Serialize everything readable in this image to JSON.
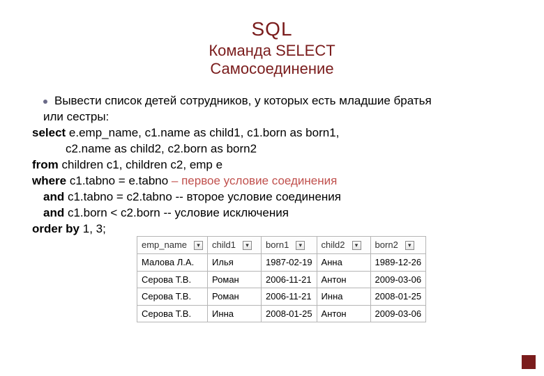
{
  "title": "SQL",
  "subtitle": "Команда SELECT",
  "subtitle2": "Самосоединение",
  "bullet_lead": "Вывести список детей сотрудников, у которых есть младшие братья",
  "bullet_tail": "или сестры:",
  "sql": {
    "select_kw": "select",
    "select_line": " e.emp_name, c1.name as child1, c1.born as born1,",
    "select_line2": "c2.name as  child2, c2.born as born2",
    "from_kw": "from",
    "from_line": " children c1, children c2, emp e",
    "where_kw": "where",
    "where_line": " c1.tabno = e.tabno ",
    "where_comment": "– первое условие соединения",
    "and1_kw": "and",
    "and1_line": " c1.tabno = c2.tabno -- второе условие соединения",
    "and2_kw": "and",
    "and2_line": " c1.born < c2.born   -- условие исключения",
    "orderby_kw": "order by",
    "orderby_line": " 1, 3;"
  },
  "table": {
    "headers": [
      "emp_name",
      "child1",
      "born1",
      "child2",
      "born2"
    ],
    "rows": [
      [
        "Малова Л.А.",
        "Илья",
        "1987-02-19",
        "Анна",
        "1989-12-26"
      ],
      [
        "Серова Т.В.",
        "Роман",
        "2006-11-21",
        "Антон",
        "2009-03-06"
      ],
      [
        "Серова Т.В.",
        "Роман",
        "2006-11-21",
        "Инна",
        "2008-01-25"
      ],
      [
        "Серова Т.В.",
        "Инна",
        "2008-01-25",
        "Антон",
        "2009-03-06"
      ]
    ]
  }
}
